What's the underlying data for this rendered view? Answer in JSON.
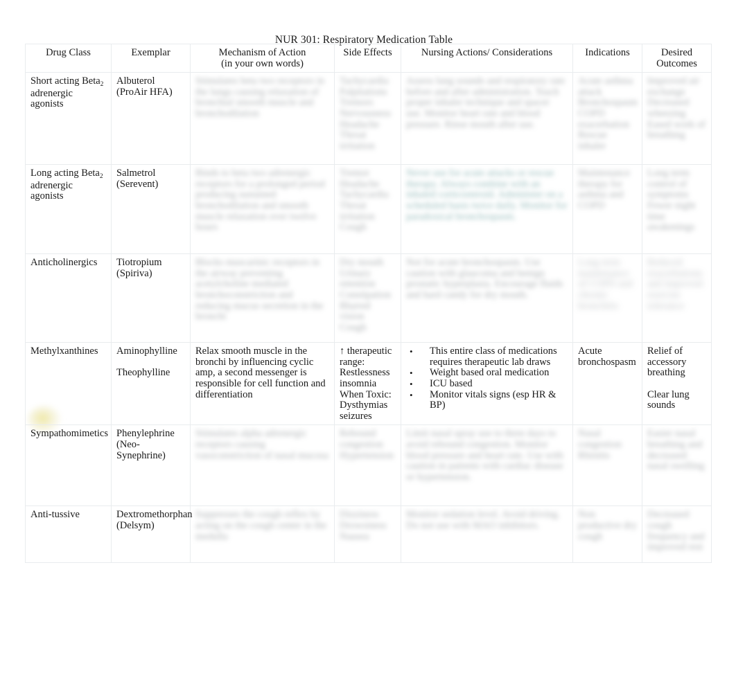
{
  "document": {
    "title": "NUR 301: Respiratory Medication Table"
  },
  "table": {
    "headers": [
      {
        "label": "Drug Class",
        "sub": ""
      },
      {
        "label": "Exemplar",
        "sub": ""
      },
      {
        "label": "Mechanism of Action",
        "sub": "(in your own words)"
      },
      {
        "label": "Side Effects",
        "sub": ""
      },
      {
        "label": "Nursing Actions/ Considerations",
        "sub": ""
      },
      {
        "label": "Indications",
        "sub": ""
      },
      {
        "label": "Desired",
        "sub": "Outcomes"
      }
    ],
    "rows": [
      {
        "drug_class": "Short acting Beta",
        "drug_class_sub": "2",
        "drug_class_rest": "adrenergic agonists",
        "exemplar": "Albuterol (ProAir HFA)",
        "mechanism": "Stimulates beta two receptors in the lungs causing relaxation of bronchial smooth muscle and bronchodilation",
        "side_effects": "Tachycardia\nPalpitations\nTremors\nNervousness\nHeadache\nThroat irritation",
        "nursing_actions": "Assess lung sounds and respiratory rate before and after administration. Teach proper inhaler technique and spacer use. Monitor heart rate and blood pressure. Rinse mouth after use.",
        "indications": "Acute asthma attack\nBronchospasm\nCOPD exacerbation\nRescue inhaler",
        "outcomes": "Improved air exchange\nDecreased wheezing\nEased work of breathing",
        "obscured": true
      },
      {
        "drug_class": "Long acting Beta",
        "drug_class_sub": "2",
        "drug_class_rest": "adrenergic agonists",
        "exemplar": "Salmetrol (Serevent)",
        "mechanism": "Binds to beta two adrenergic receptors for a prolonged period producing sustained bronchodilation and smooth muscle relaxation over twelve hours",
        "side_effects": "Tremor\nHeadache\nTachycardia\nThroat irritation\nCough",
        "nursing_actions": "Never use for acute attacks or rescue therapy. Always combine with an inhaled corticosteroid. Administer on a scheduled basis twice daily. Monitor for paradoxical bronchospasm.",
        "indications": "Maintenance therapy for asthma and COPD",
        "outcomes": "Long term control of symptoms\nFewer night time awakenings",
        "obscured": true
      },
      {
        "drug_class": "Anticholinergics",
        "drug_class_sub": "",
        "drug_class_rest": "",
        "exemplar": "Tiotropium (Spiriva)",
        "mechanism": "Blocks muscarinic receptors in the airway preventing acetylcholine mediated bronchoconstriction and reducing mucus secretion in the bronchi",
        "side_effects": "Dry mouth\nUrinary retention\nConstipation\nBlurred vision\nCough",
        "nursing_actions": "Not for acute bronchospasm. Use caution with glaucoma and benign prostatic hyperplasia. Encourage fluids and hard candy for dry mouth.",
        "indications": "Long term maintenance of COPD and chronic bronchitis",
        "outcomes": "Reduced exacerbations and improved exercise tolerance",
        "obscured": true
      },
      {
        "drug_class": "Methylxanthines",
        "drug_class_sub": "",
        "drug_class_rest": "",
        "exemplar": "Aminophylline",
        "exemplar2": "Theophylline",
        "mechanism": "Relax smooth muscle in the bronchi by influencing cyclic amp, a second messenger is responsible for cell function and differentiation",
        "side_effects": "↑ therapeutic range:\nRestlessness insomnia\nWhen Toxic: Dysthymias seizures",
        "nursing_bullets": [
          "This entire class of medications requires therapeutic lab draws",
          "Weight based oral medication",
          "ICU based",
          "Monitor vitals signs (esp HR & BP)"
        ],
        "indications": "Acute bronchospasm",
        "outcomes": "Relief of accessory breathing",
        "outcomes2": "Clear lung sounds",
        "obscured": false
      },
      {
        "drug_class": "Sympathomimetics",
        "drug_class_sub": "",
        "drug_class_rest": "",
        "exemplar": "Phenylephrine (Neo-Synephrine)",
        "mechanism": "Stimulates alpha adrenergic receptors causing vasoconstriction of nasal mucosa",
        "side_effects": "Rebound congestion\nHypertension",
        "nursing_actions": "Limit nasal spray use to three days to avoid rebound congestion. Monitor blood pressure and heart rate. Use with caution in patients with cardiac disease or hypertension.",
        "indications": "Nasal congestion\nRhinitis",
        "outcomes": "Easier nasal breathing and decreased nasal swelling",
        "obscured": true,
        "highlight": true
      },
      {
        "drug_class": "Anti-tussive",
        "drug_class_sub": "",
        "drug_class_rest": "",
        "exemplar": "Dextromethorphan (Delsym)",
        "mechanism": "Suppresses the cough reflex by acting on the cough center in the medulla",
        "side_effects": "Dizziness\nDrowsiness\nNausea",
        "nursing_actions": "Monitor sedation level. Avoid driving. Do not use with MAO inhibitors.",
        "indications": "Non productive dry cough",
        "outcomes": "Decreased cough frequency and improved rest",
        "obscured": true
      }
    ]
  },
  "colors": {
    "border": "#e9ecee",
    "text": "#1a1a1a",
    "highlight": "#ece496"
  }
}
